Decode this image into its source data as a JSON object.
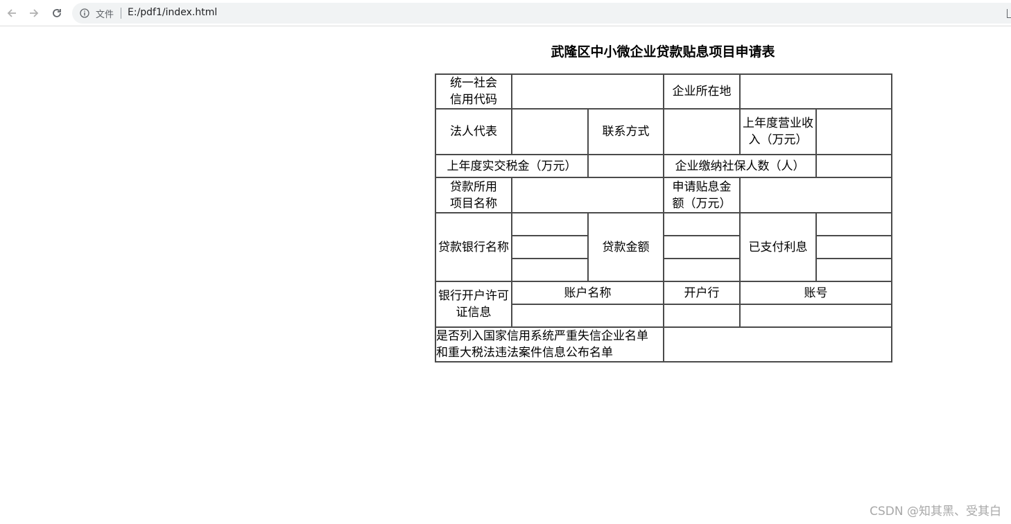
{
  "browser": {
    "url_scheme_label": "文件",
    "url": "E:/pdf1/index.html"
  },
  "page": {
    "title": "武隆区中小微企业贷款贴息项目申请表",
    "form": {
      "credit_code_label": "统一社会信用代码",
      "location_label": "企业所在地",
      "legal_rep_label": "法人代表",
      "contact_label": "联系方式",
      "revenue_label": "上年度营业收入（万元）",
      "tax_label": "上年度实交税金（万元）",
      "social_security_label": "企业缴纳社保人数（人）",
      "loan_project_label": "贷款所用项目名称",
      "subsidy_amount_label": "申请贴息金额（万元）",
      "bank_name_label": "贷款银行名称",
      "loan_amount_label": "贷款金额",
      "interest_paid_label": "已支付利息",
      "license_info_label": "银行开户许可证信息",
      "account_name_label": "账户名称",
      "open_bank_label": "开户行",
      "account_number_label": "账号",
      "blacklist_label": "是否列入国家信用系统严重失信企业名单和重大税法违法案件信息公布名单"
    },
    "watermark": "CSDN @知其黑、受其白"
  },
  "colors": {
    "border": "#4a4a4a",
    "omnibox_bg": "#f1f3f4",
    "watermark": "#a8a8a8"
  }
}
